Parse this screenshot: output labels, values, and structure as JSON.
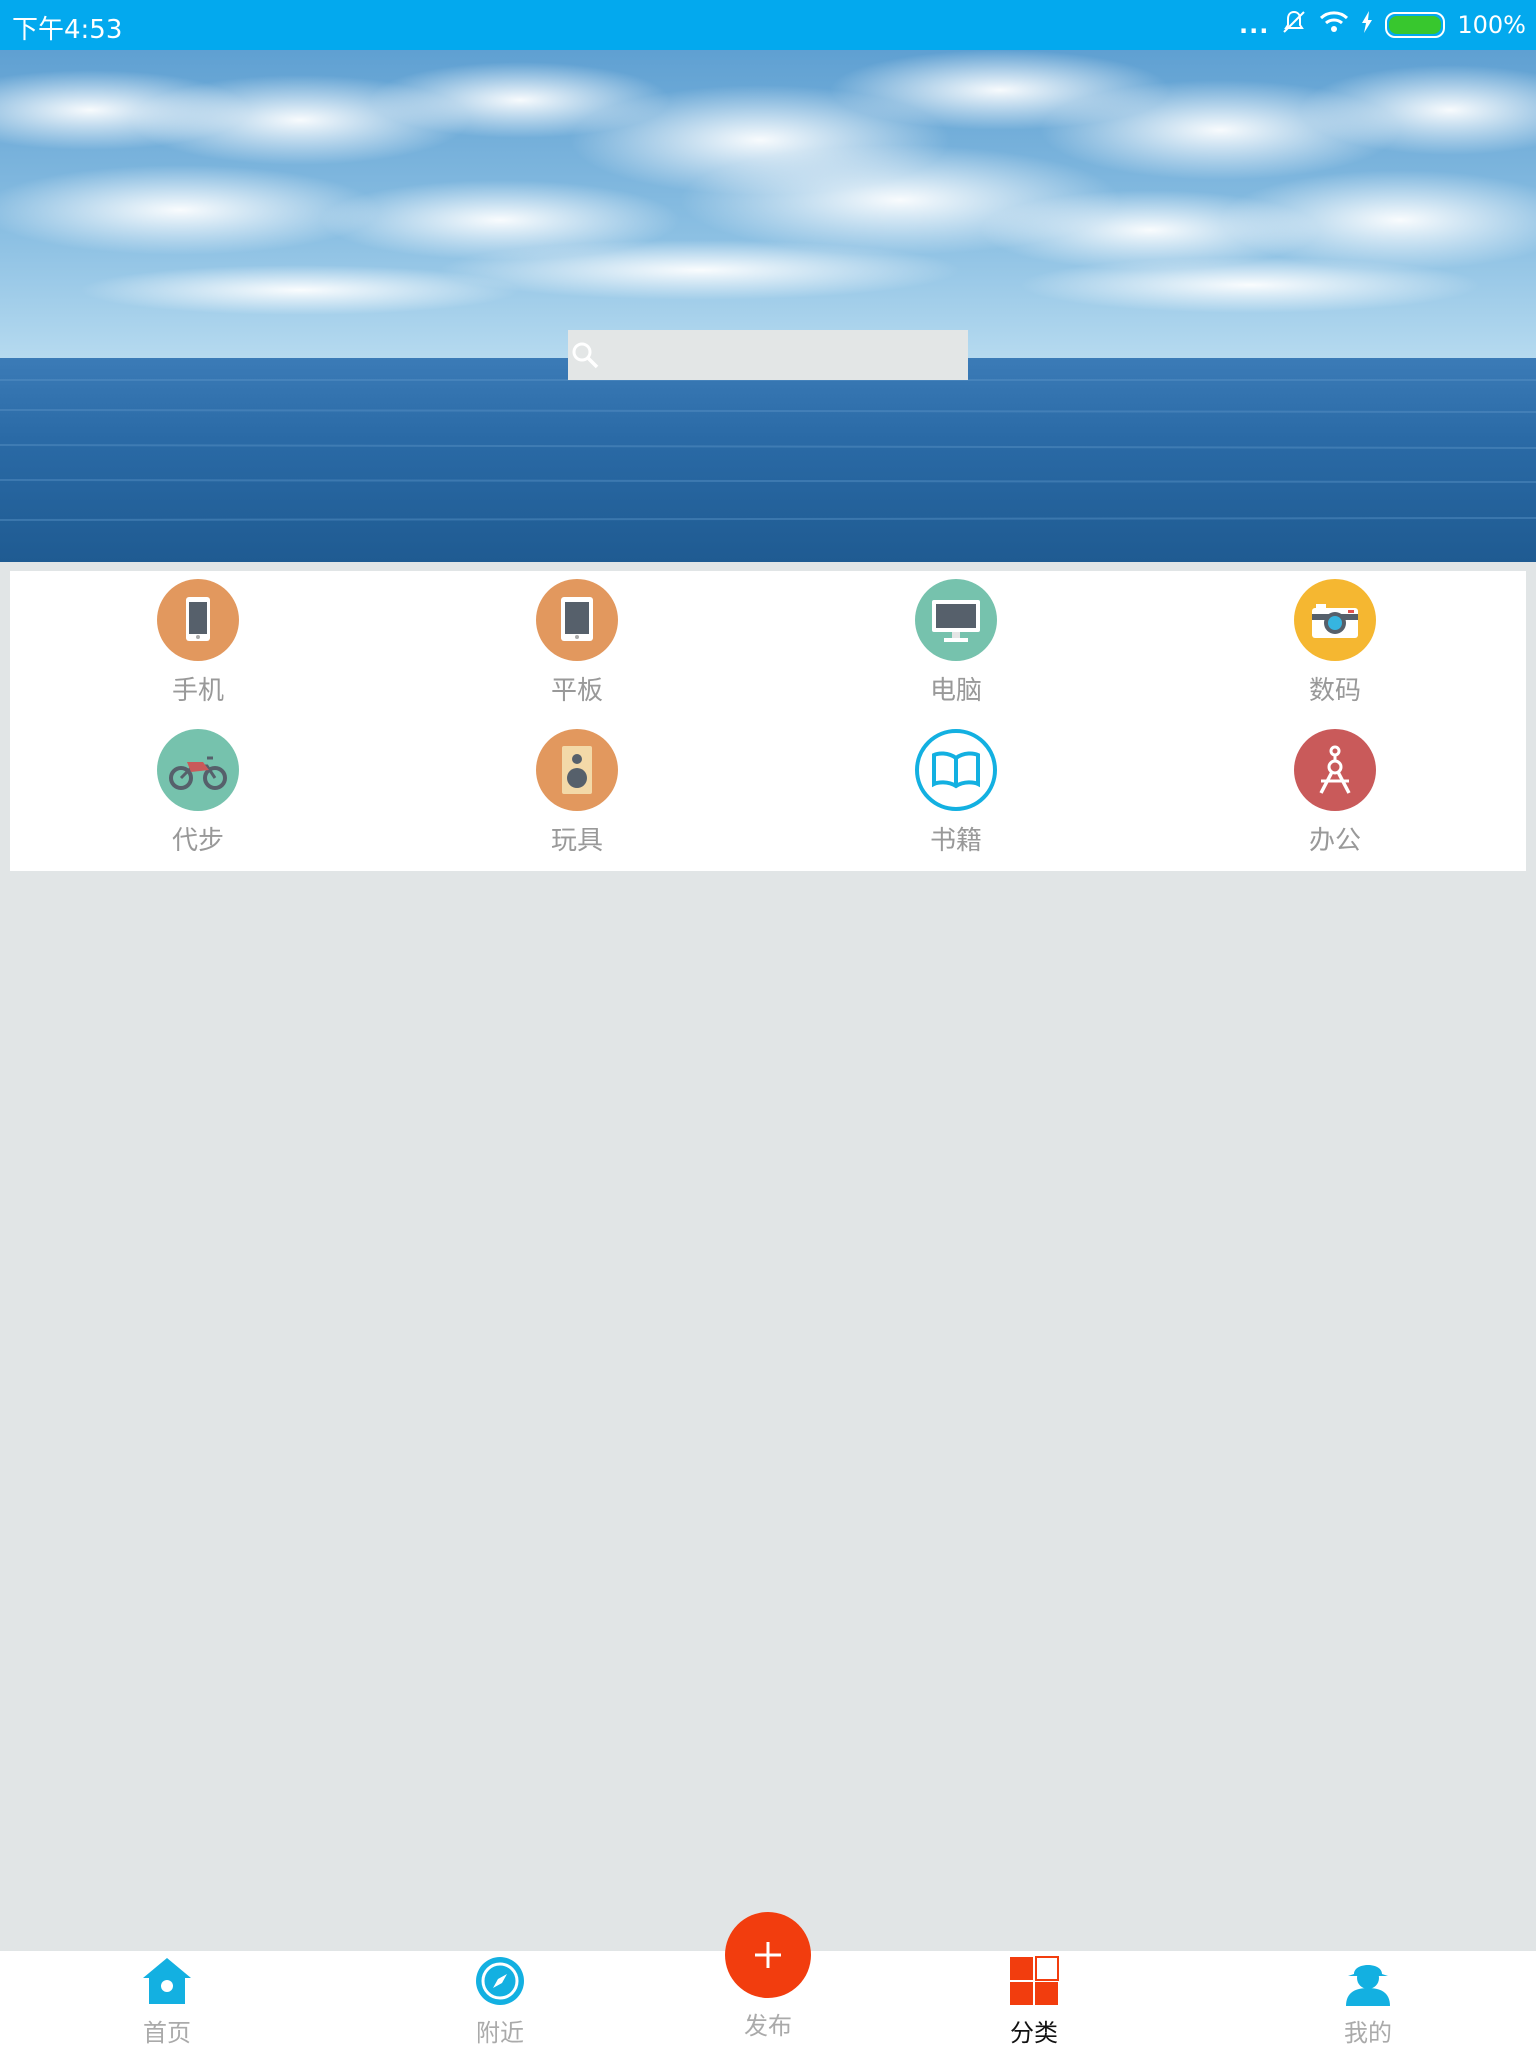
{
  "status_bar": {
    "time": "下午4:53",
    "dots": "...",
    "battery_percent": "100%",
    "icons": [
      "mute-bell-icon",
      "wifi-icon",
      "charging-icon",
      "battery-icon"
    ]
  },
  "banner": {
    "image": "sea-and-sky-banner",
    "search": {
      "placeholder": "",
      "value": ""
    }
  },
  "categories": [
    {
      "label": "手机",
      "icon": "phone-icon",
      "color": "#e2985e"
    },
    {
      "label": "平板",
      "icon": "tablet-icon",
      "color": "#e2985e"
    },
    {
      "label": "电脑",
      "icon": "monitor-icon",
      "color": "#76c2ad"
    },
    {
      "label": "数码",
      "icon": "camera-icon",
      "color": "#f5b731"
    },
    {
      "label": "代步",
      "icon": "motorbike-icon",
      "color": "#76c2ad"
    },
    {
      "label": "玩具",
      "icon": "speaker-icon",
      "color": "#e2985e"
    },
    {
      "label": "书籍",
      "icon": "book-icon",
      "color": "#13b0e1"
    },
    {
      "label": "办公",
      "icon": "compass-drafting-icon",
      "color": "#c95a5a"
    }
  ],
  "bottom_nav": {
    "items": [
      {
        "label": "首页",
        "icon": "home-icon"
      },
      {
        "label": "附近",
        "icon": "compass-icon"
      },
      {
        "label": "发布",
        "icon": "plus-icon"
      },
      {
        "label": "分类",
        "icon": "category-grid-icon",
        "active": true
      },
      {
        "label": "我的",
        "icon": "user-icon"
      }
    ]
  },
  "colors": {
    "status_bar": "#03a9ee",
    "accent_blue": "#13b0e1",
    "publish_red": "#f23d0e",
    "background": "#e1e5e6"
  }
}
